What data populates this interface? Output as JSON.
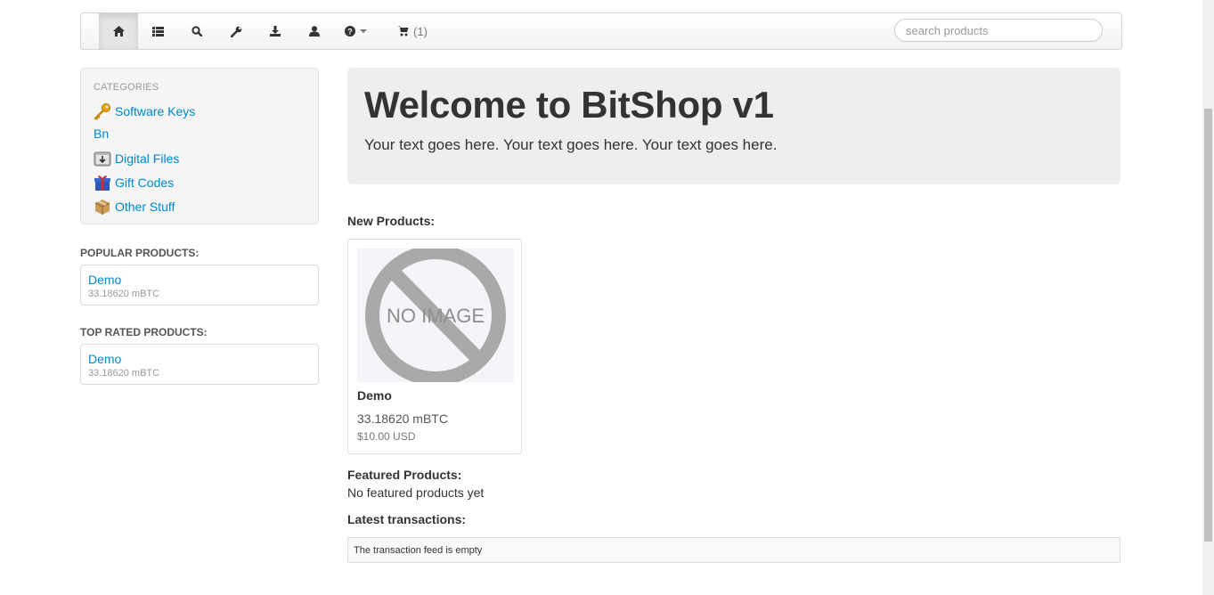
{
  "navbar": {
    "items": [
      {
        "name": "home",
        "icon": "home-icon"
      },
      {
        "name": "list",
        "icon": "list-icon"
      },
      {
        "name": "search",
        "icon": "search-icon"
      },
      {
        "name": "wrench",
        "icon": "wrench-icon"
      },
      {
        "name": "download",
        "icon": "download-icon"
      },
      {
        "name": "user",
        "icon": "user-icon"
      },
      {
        "name": "help",
        "icon": "question-circle-icon"
      },
      {
        "name": "cart",
        "icon": "shopping-cart-icon"
      }
    ],
    "cart_count": "(1)",
    "search_placeholder": "search products"
  },
  "sidebar": {
    "categories_header": "CATEGORIES",
    "categories": [
      {
        "label": "Software Keys",
        "icon": "key-icon"
      },
      {
        "label": "Bn",
        "icon": ""
      },
      {
        "label": "Digital Files",
        "icon": "download-box-icon"
      },
      {
        "label": "Gift Codes",
        "icon": "gift-icon"
      },
      {
        "label": "Other Stuff",
        "icon": "package-icon"
      }
    ],
    "popular_header": "POPULAR PRODUCTS:",
    "popular": {
      "name": "Demo",
      "price": "33.18620 mBTC"
    },
    "top_rated_header": "TOP RATED PRODUCTS:",
    "top_rated": {
      "name": "Demo",
      "price": "33.18620 mBTC"
    }
  },
  "hero": {
    "title": "Welcome to BitShop v1",
    "text": "Your text goes here. Your text goes here. Your text goes here."
  },
  "main": {
    "new_products_label": "New Products:",
    "product": {
      "image_text": "NO IMAGE",
      "name": "Demo",
      "price_btc": "33.18620 mBTC",
      "price_usd": "$10.00 USD"
    },
    "featured_label": "Featured Products:",
    "featured_empty": "No featured products yet",
    "transactions_label": "Latest transactions:",
    "transactions_empty": "The transaction feed is empty"
  }
}
